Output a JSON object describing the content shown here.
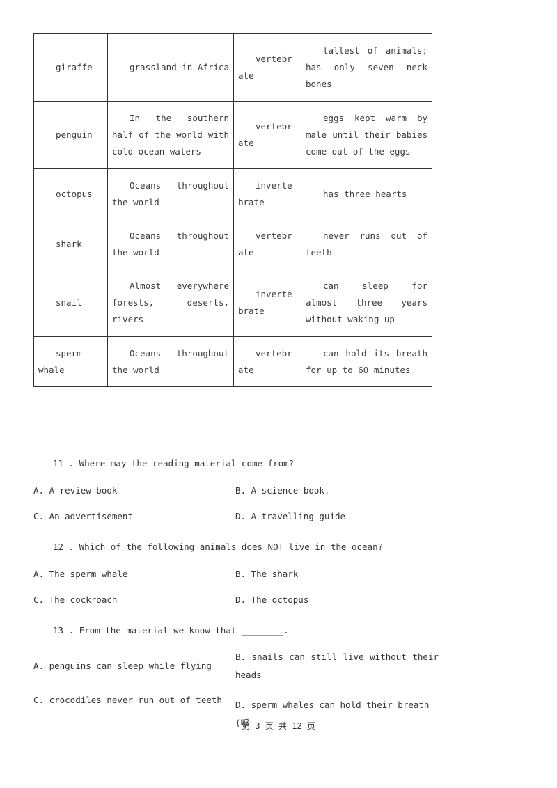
{
  "table": {
    "rows": [
      {
        "animal": "giraffe",
        "habitat": "grassland in Africa",
        "type": "vertebrate",
        "fact": "tallest of animals; has only seven neck bones"
      },
      {
        "animal": "penguin",
        "habitat": "In the southern half of the world with cold ocean waters",
        "type": "vertebrate",
        "fact": "eggs kept warm by male until their babies come out of the eggs"
      },
      {
        "animal": "octopus",
        "habitat": "Oceans throughout the world",
        "type": "invertebrate",
        "fact": "has three hearts"
      },
      {
        "animal": "shark",
        "habitat": "Oceans throughout the world",
        "type": "vertebrate",
        "fact": "never runs out of teeth"
      },
      {
        "animal": "snail",
        "habitat": "Almost everywhere forests, deserts, rivers",
        "type": "invertebrate",
        "fact": "can sleep for almost three years without waking up"
      },
      {
        "animal": "sperm whale",
        "habitat": "Oceans throughout the world",
        "type": "vertebrate",
        "fact": "can hold its breath for up to 60 minutes"
      }
    ]
  },
  "questions": [
    {
      "text": "11 . Where may the reading material come from?",
      "options": {
        "A": "A. A review book",
        "B": "B. A science book.",
        "C": "C. An advertisement",
        "D": "D. A travelling guide"
      }
    },
    {
      "text": "12 . Which of the following animals does NOT live in the ocean?",
      "options": {
        "A": "A. The sperm whale",
        "B": "B. The shark",
        "C": "C. The cockroach",
        "D": "D. The octopus"
      }
    },
    {
      "text": "13 . From the material we know that ________.",
      "options": {
        "A": "A. penguins can sleep while flying",
        "B": "B. snails can still live without their heads",
        "C": "C. crocodiles never run out of teeth",
        "D": "D. sperm whales can hold their breath (呼"
      }
    }
  ],
  "footer": "第 3 页 共 12 页"
}
